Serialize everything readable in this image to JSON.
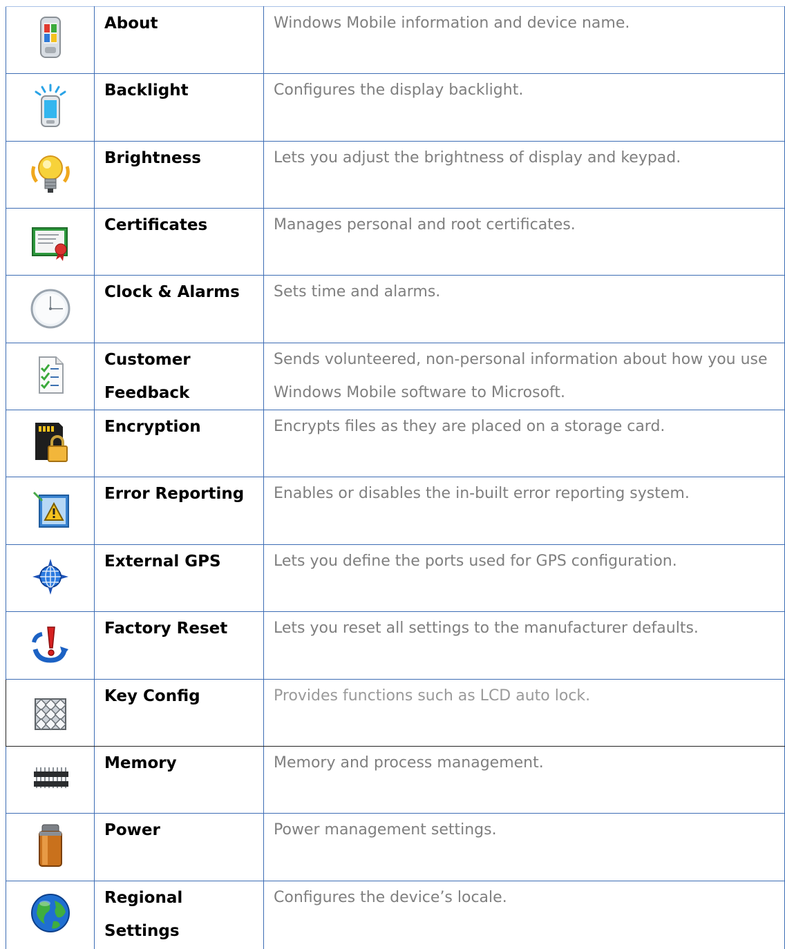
{
  "rows": [
    {
      "name": "About",
      "description": "Windows Mobile information and device name.",
      "icon": "phone-icon"
    },
    {
      "name": "Backlight",
      "description": "Configures the display backlight.",
      "icon": "backlight-icon"
    },
    {
      "name": "Brightness",
      "description": "Lets you adjust the brightness of display and keypad.",
      "icon": "lightbulb-icon"
    },
    {
      "name": "Certificates",
      "description": "Manages personal and root certificates.",
      "icon": "certificate-icon"
    },
    {
      "name": "Clock & Alarms",
      "description": "Sets time and alarms.",
      "icon": "clock-icon"
    },
    {
      "name": "Customer Feedback",
      "description": "Sends volunteered, non-personal information about how you use Windows Mobile software to Microsoft.",
      "icon": "checklist-icon"
    },
    {
      "name": "Encryption",
      "description": "Encrypts files as they are placed on a storage card.",
      "icon": "storage-card-lock-icon"
    },
    {
      "name": "Error Reporting",
      "description": "Enables or disables the in-built error reporting system.",
      "icon": "warning-icon"
    },
    {
      "name": "External GPS",
      "description": "Lets you define the ports used for GPS configuration.",
      "icon": "gps-globe-icon"
    },
    {
      "name": "Factory Reset",
      "description": "Lets you reset all settings to the manufacturer defaults.",
      "icon": "reset-icon"
    },
    {
      "name": "Key Config",
      "description": "Provides functions such as LCD auto lock.",
      "icon": "keypad-icon"
    },
    {
      "name": "Memory",
      "description": "Memory and process management.",
      "icon": "memory-chip-icon"
    },
    {
      "name": "Power",
      "description": "Power management settings.",
      "icon": "battery-icon"
    },
    {
      "name": "Regional Settings",
      "description": "Configures the device’s locale.",
      "icon": "globe-icon"
    }
  ]
}
